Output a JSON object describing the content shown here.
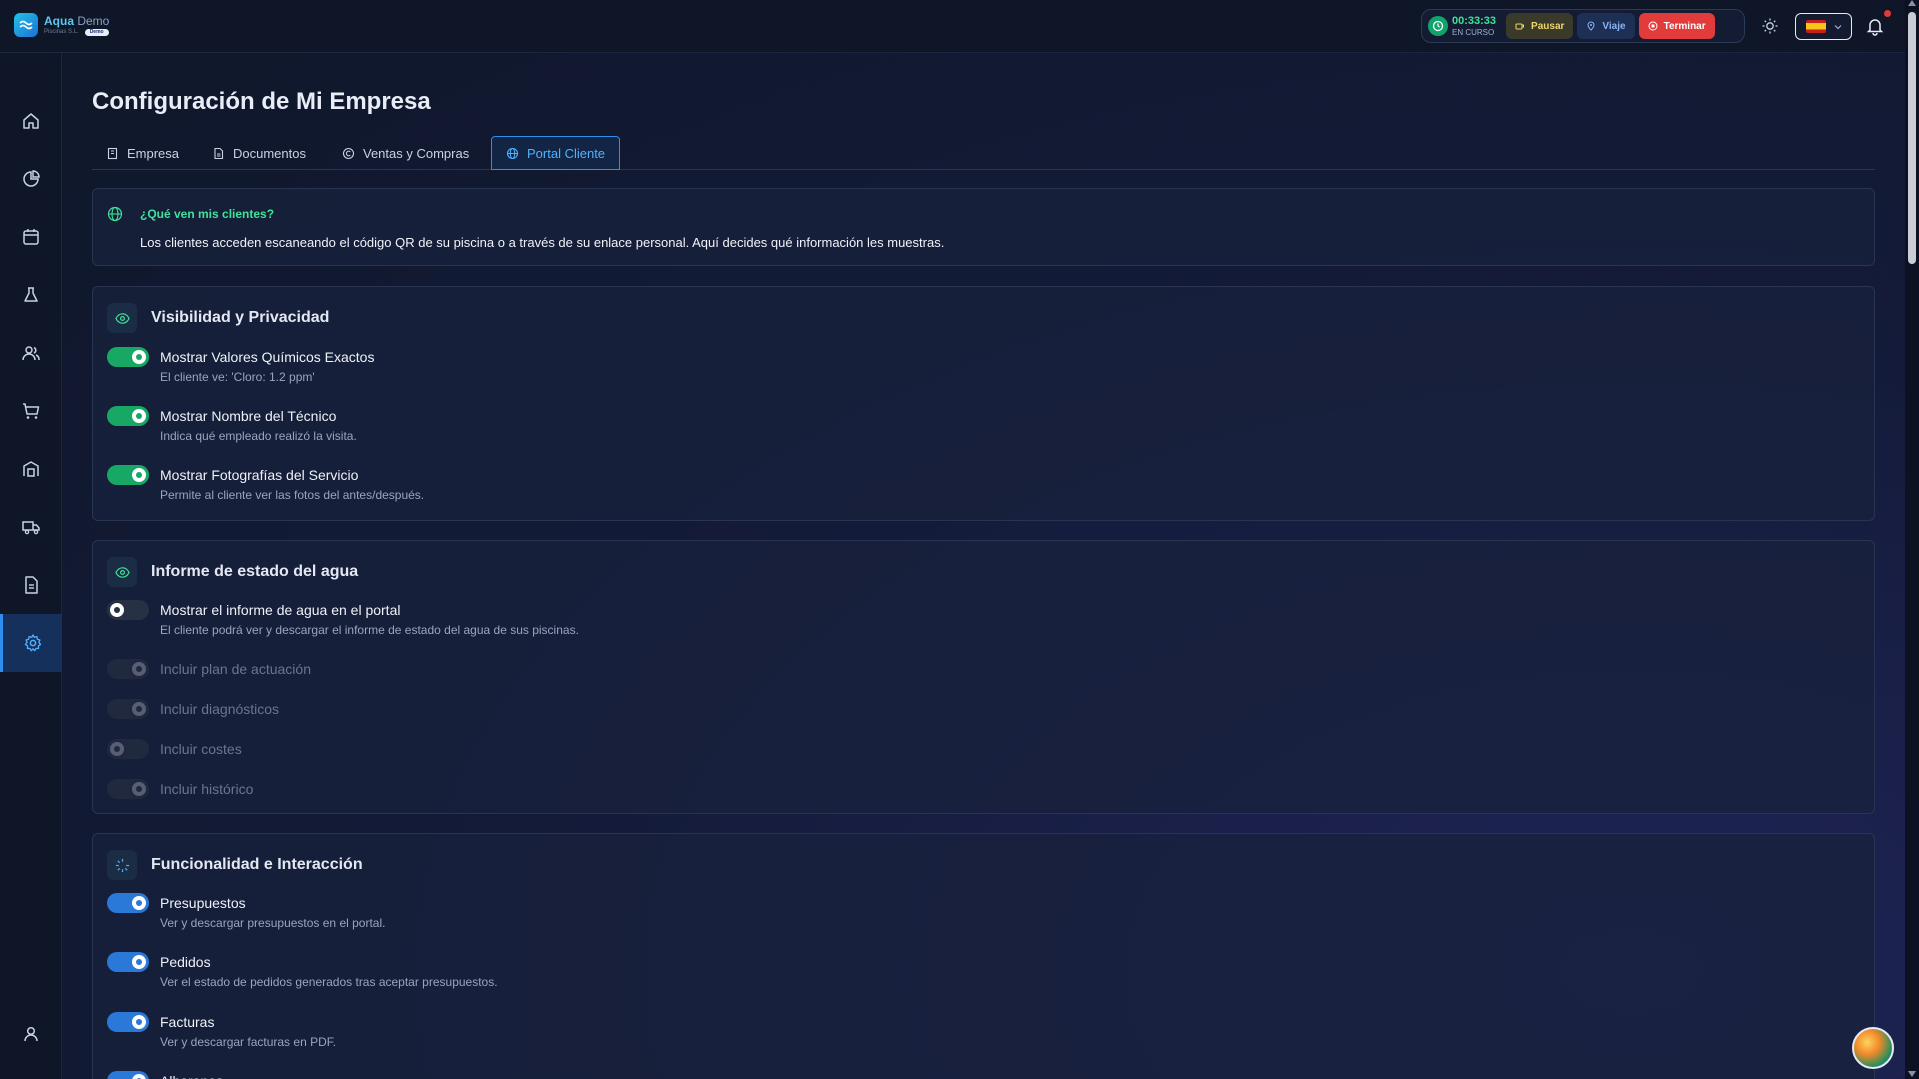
{
  "app": {
    "name": "Aqua",
    "name_suffix": "Demo",
    "subtitle": "Piscinas S.L.",
    "badge": "Demo"
  },
  "topbar": {
    "timer_value": "00:33:33",
    "timer_status": "EN CURSO",
    "pause_label": "Pausar",
    "trip_label": "Viaje",
    "end_label": "Terminar",
    "language": "es"
  },
  "page": {
    "title": "Configuración de Mi Empresa"
  },
  "tabs": [
    {
      "label": "Empresa",
      "icon": "building-icon",
      "active": false
    },
    {
      "label": "Documentos",
      "icon": "document-icon",
      "active": false
    },
    {
      "label": "Ventas y Compras",
      "icon": "coin-icon",
      "active": false
    },
    {
      "label": "Portal Cliente",
      "icon": "globe-icon",
      "active": true
    }
  ],
  "info": {
    "title": "¿Qué ven mis clientes?",
    "text": "Los clientes acceden escaneando el código QR de su piscina o a través de su enlace personal. Aquí decides qué información les muestras."
  },
  "sections": {
    "visibility": {
      "title": "Visibilidad y Privacidad",
      "options": [
        {
          "label": "Mostrar Valores Químicos Exactos",
          "desc": "El cliente ve: 'Cloro: 1.2 ppm'",
          "enabled": true
        },
        {
          "label": "Mostrar Nombre del Técnico",
          "desc": "Indica qué empleado realizó la visita.",
          "enabled": true
        },
        {
          "label": "Mostrar Fotografías del Servicio",
          "desc": "Permite al cliente ver las fotos del antes/después.",
          "enabled": true
        }
      ]
    },
    "water_report": {
      "title": "Informe de estado del agua",
      "main_option": {
        "label": "Mostrar el informe de agua en el portal",
        "desc": "El cliente podrá ver y descargar el informe de estado del agua de sus piscinas.",
        "enabled": false
      },
      "sub_options": [
        {
          "label": "Incluir plan de actuación",
          "enabled": true,
          "disabled": true
        },
        {
          "label": "Incluir diagnósticos",
          "enabled": true,
          "disabled": true
        },
        {
          "label": "Incluir costes",
          "enabled": false,
          "disabled": true
        },
        {
          "label": "Incluir histórico",
          "enabled": true,
          "disabled": true
        }
      ]
    },
    "functionality": {
      "title": "Funcionalidad e Interacción",
      "options": [
        {
          "label": "Presupuestos",
          "desc": "Ver y descargar presupuestos en el portal.",
          "enabled": true
        },
        {
          "label": "Pedidos",
          "desc": "Ver el estado de pedidos generados tras aceptar presupuestos.",
          "enabled": true
        },
        {
          "label": "Facturas",
          "desc": "Ver y descargar facturas en PDF.",
          "enabled": true
        },
        {
          "label": "Albaranes",
          "desc": "",
          "enabled": true
        }
      ]
    }
  },
  "sidebar": [
    {
      "icon": "home-icon",
      "active": false
    },
    {
      "icon": "chart-pie-icon",
      "active": false
    },
    {
      "icon": "calendar-icon",
      "active": false
    },
    {
      "icon": "flask-icon",
      "active": false
    },
    {
      "icon": "users-icon",
      "active": false
    },
    {
      "icon": "cart-icon",
      "active": false
    },
    {
      "icon": "warehouse-icon",
      "active": false
    },
    {
      "icon": "truck-icon",
      "active": false
    },
    {
      "icon": "invoice-icon",
      "active": false
    },
    {
      "icon": "settings-icon",
      "active": true
    },
    {
      "icon": "user-icon",
      "active": false
    }
  ],
  "colors": {
    "accent": "#2f8df0",
    "success": "#17a866",
    "danger": "#e23b3b",
    "background": "#141b3a"
  }
}
